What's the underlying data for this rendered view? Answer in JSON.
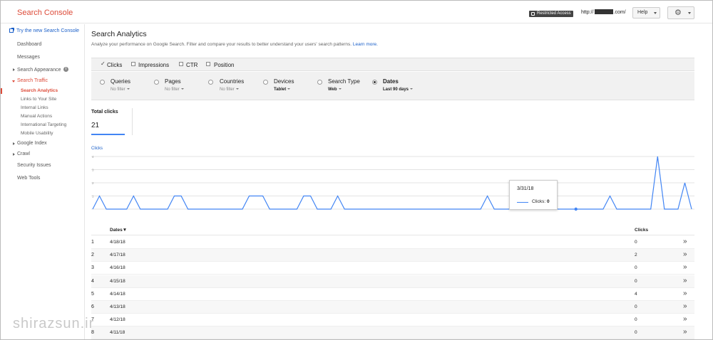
{
  "header": {
    "brand": "Search Console",
    "restricted_label": "Restricted Access",
    "site_prefix": "http://",
    "site_suffix": ".com/",
    "help_label": "Help",
    "gear_icon": "gear-icon"
  },
  "sidebar": {
    "new_link": "Try the new Search Console",
    "items": {
      "dashboard": "Dashboard",
      "messages": "Messages",
      "search_appearance": "Search Appearance",
      "search_traffic": "Search Traffic",
      "google_index": "Google Index",
      "crawl": "Crawl",
      "security_issues": "Security Issues",
      "web_tools": "Web Tools"
    },
    "traffic_sub": {
      "search_analytics": "Search Analytics",
      "links": "Links to Your Site",
      "internal_links": "Internal Links",
      "manual_actions": "Manual Actions",
      "intl_targeting": "International Targeting",
      "mobile_usability": "Mobile Usability"
    },
    "info_icon": "i"
  },
  "main": {
    "title": "Search Analytics",
    "description": "Analyze your performance on Google Search. Filter and compare your results to better understand your users' search patterns.",
    "learn_more": "Learn more.",
    "metrics": {
      "clicks": "Clicks",
      "impressions": "Impressions",
      "ctr": "CTR",
      "position": "Position",
      "check": "✓"
    },
    "filters": {
      "queries": {
        "label": "Queries",
        "value": "No filter"
      },
      "pages": {
        "label": "Pages",
        "value": "No filter"
      },
      "countries": {
        "label": "Countries",
        "value": "No filter"
      },
      "devices": {
        "label": "Devices",
        "value": "Tablet"
      },
      "search_type": {
        "label": "Search Type",
        "value": "Web"
      },
      "dates": {
        "label": "Dates",
        "value": "Last 90 days"
      }
    },
    "total": {
      "label": "Total clicks",
      "value": "21"
    },
    "tooltip": {
      "date": "3/31/18",
      "label": "Clicks:",
      "value": "0"
    },
    "table": {
      "headers": {
        "dates": "Dates▼",
        "clicks": "Clicks"
      },
      "rows": [
        {
          "idx": "1",
          "date": "4/18/18",
          "clicks": "0"
        },
        {
          "idx": "2",
          "date": "4/17/18",
          "clicks": "2"
        },
        {
          "idx": "3",
          "date": "4/16/18",
          "clicks": "0"
        },
        {
          "idx": "4",
          "date": "4/15/18",
          "clicks": "0"
        },
        {
          "idx": "5",
          "date": "4/14/18",
          "clicks": "4"
        },
        {
          "idx": "6",
          "date": "4/13/18",
          "clicks": "0"
        },
        {
          "idx": "7",
          "date": "4/12/18",
          "clicks": "0"
        },
        {
          "idx": "8",
          "date": "4/11/18",
          "clicks": "0"
        }
      ],
      "more_glyph": "»"
    }
  },
  "watermark": "shirazsun.ir",
  "chart_data": {
    "type": "line",
    "title": "",
    "ylabel": "Clicks",
    "ylim": [
      0,
      4
    ],
    "yticks": [
      "1",
      "2",
      "3",
      "4"
    ],
    "grid": true,
    "legend": "none",
    "color": "#4285f4",
    "series": [
      {
        "name": "Clicks",
        "values": [
          0,
          1,
          0,
          0,
          0,
          0,
          1,
          0,
          0,
          0,
          0,
          0,
          1,
          1,
          0,
          0,
          0,
          0,
          0,
          0,
          0,
          0,
          0,
          1,
          1,
          1,
          0,
          0,
          0,
          0,
          0,
          1,
          1,
          0,
          0,
          0,
          1,
          0,
          0,
          0,
          0,
          0,
          0,
          0,
          0,
          0,
          0,
          0,
          0,
          0,
          0,
          0,
          0,
          0,
          0,
          0,
          0,
          0,
          1,
          0,
          0,
          0,
          0,
          0,
          0,
          0,
          0,
          0,
          0,
          0,
          0,
          0,
          0,
          0,
          0,
          0,
          1,
          0,
          0,
          0,
          0,
          0,
          0,
          4,
          0,
          0,
          0,
          2,
          0
        ]
      }
    ],
    "highlight_index": 71
  }
}
